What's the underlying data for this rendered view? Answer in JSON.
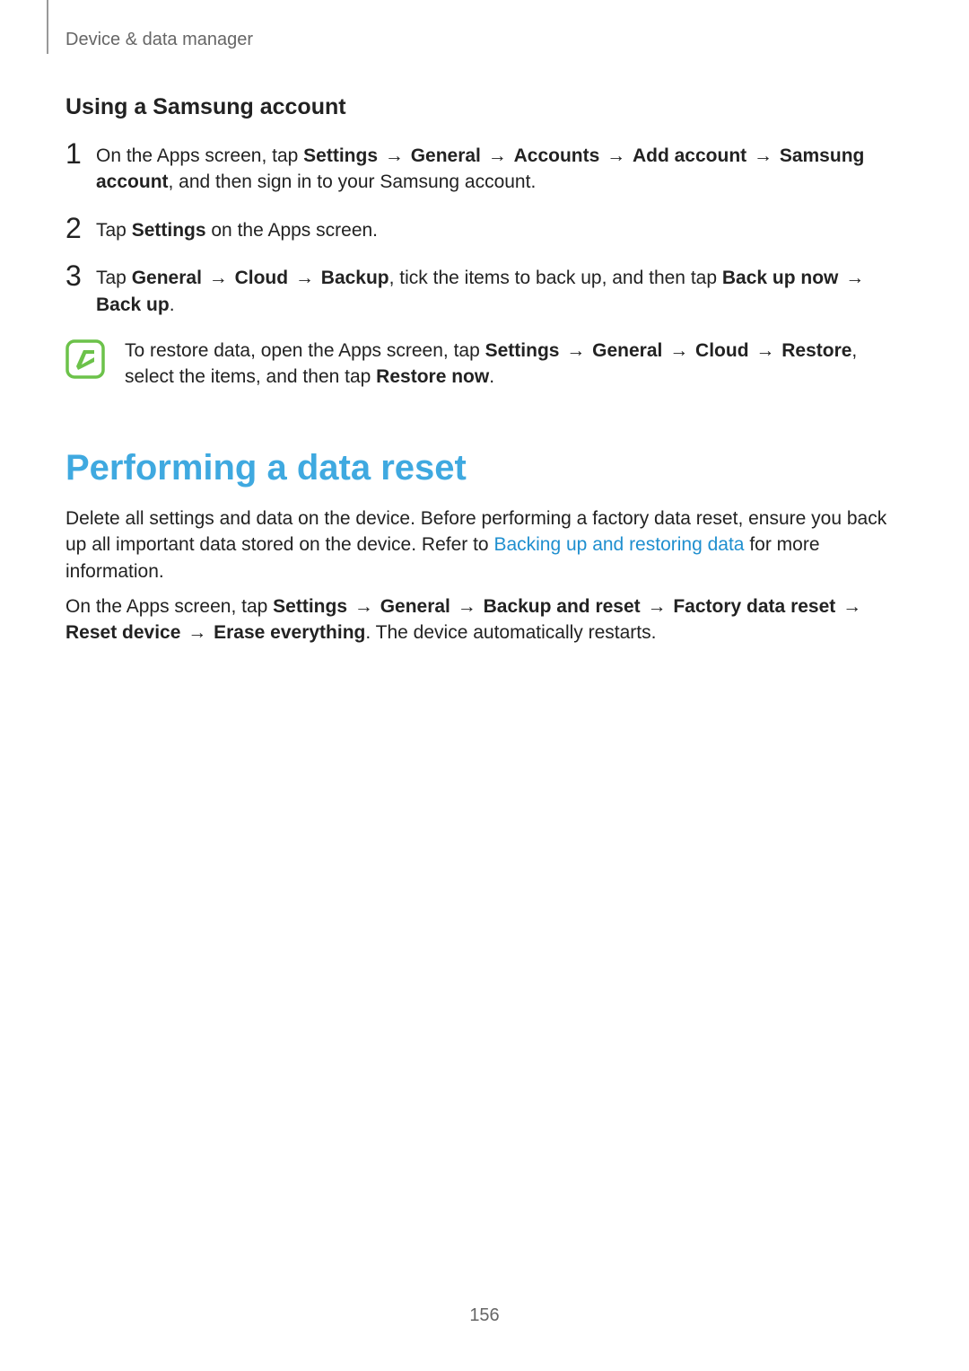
{
  "runningHead": "Device & data manager",
  "pageNumber": "156",
  "arrow": "→",
  "samsung": {
    "heading": "Using a Samsung account",
    "steps": [
      {
        "num": "1",
        "pre": "On the Apps screen, tap ",
        "path": [
          "Settings",
          "General",
          "Accounts",
          "Add account",
          "Samsung account"
        ],
        "post": ", and then sign in to your Samsung account."
      },
      {
        "num": "2",
        "pre": "Tap ",
        "path": [
          "Settings"
        ],
        "post": " on the Apps screen."
      },
      {
        "num": "3",
        "pre": "Tap ",
        "path": [
          "General",
          "Cloud",
          "Backup"
        ],
        "mid": ", tick the items to back up, and then tap ",
        "path2": [
          "Back up now",
          "Back up"
        ],
        "post": "."
      }
    ],
    "note": {
      "pre": "To restore data, open the Apps screen, tap ",
      "path": [
        "Settings",
        "General",
        "Cloud",
        "Restore"
      ],
      "mid": ", select the items, and then tap ",
      "bold2": "Restore now",
      "post": "."
    }
  },
  "reset": {
    "heading": "Performing a data reset",
    "intro_a": "Delete all settings and data on the device. Before performing a factory data reset, ensure you back up all important data stored on the device. Refer to ",
    "intro_link": "Backing up and restoring data",
    "intro_b": " for more information.",
    "proc_pre": "On the Apps screen, tap ",
    "proc_path": [
      "Settings",
      "General",
      "Backup and reset",
      "Factory data reset",
      "Reset device",
      "Erase everything"
    ],
    "proc_post": ". The device automatically restarts."
  }
}
